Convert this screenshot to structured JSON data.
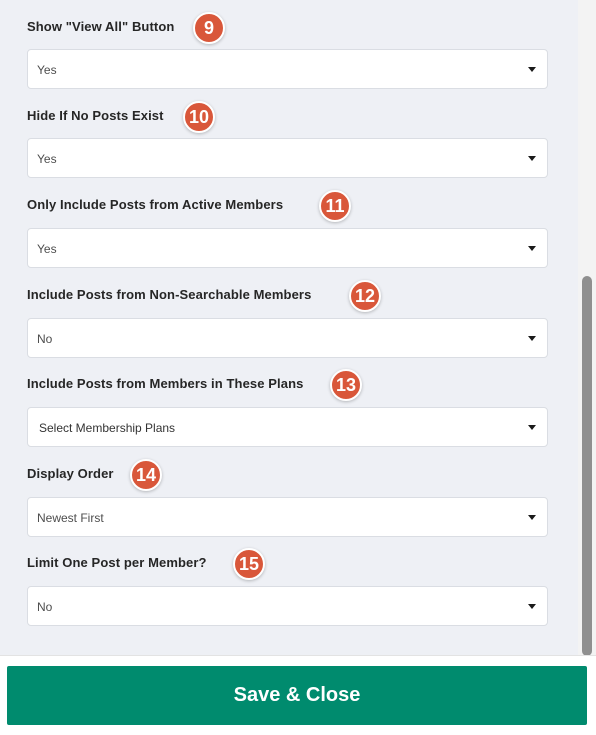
{
  "fields": [
    {
      "label": "Show \"View All\" Button",
      "badge": "9",
      "value": "Yes"
    },
    {
      "label": "Hide If No Posts Exist",
      "badge": "10",
      "value": "Yes"
    },
    {
      "label": "Only Include Posts from Active Members",
      "badge": "11",
      "value": "Yes"
    },
    {
      "label": "Include Posts from Non-Searchable Members",
      "badge": "12",
      "value": "No"
    },
    {
      "label": "Include Posts from Members in These Plans",
      "badge": "13",
      "value": "Select Membership Plans"
    },
    {
      "label": "Display Order",
      "badge": "14",
      "value": "Newest First"
    },
    {
      "label": "Limit One Post per Member?",
      "badge": "15",
      "value": "No"
    }
  ],
  "footer": {
    "save_label": "Save & Close"
  },
  "colors": {
    "badge": "#d9573a",
    "save_button": "#008b6e",
    "panel_bg": "#eef0f5"
  }
}
